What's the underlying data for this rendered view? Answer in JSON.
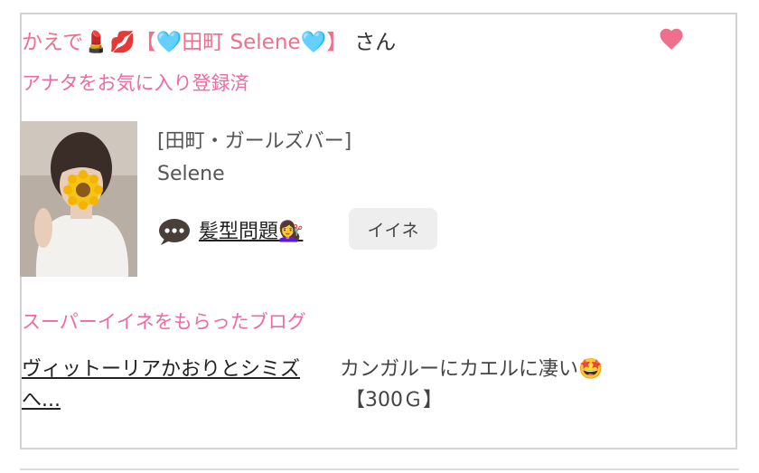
{
  "profile": {
    "customer_name": "かえで💄💋【🩵田町 Selene🩵】",
    "honorific": "さん",
    "favorite_status": "アナタをお気に入り登録済"
  },
  "girl": {
    "shop": "[田町・ガールズバー]",
    "name": "Selene",
    "latest_blog_title": "髪型問題💇‍♀️",
    "like_button": "イイネ"
  },
  "super_iine": {
    "heading": "スーパーイイネをもらったブログ",
    "items": [
      {
        "title": "ヴィットーリアかおりとシミズへ...",
        "comment": "カンガルーにカエルに凄い🤩",
        "points": "【300Ｇ】"
      }
    ]
  },
  "colors": {
    "accent_pink": "#ee6f8e",
    "label_pink": "#ec6aa5",
    "heart": "#ee6f8e"
  },
  "icons": [
    "heart-icon",
    "speech-bubble-icon"
  ]
}
